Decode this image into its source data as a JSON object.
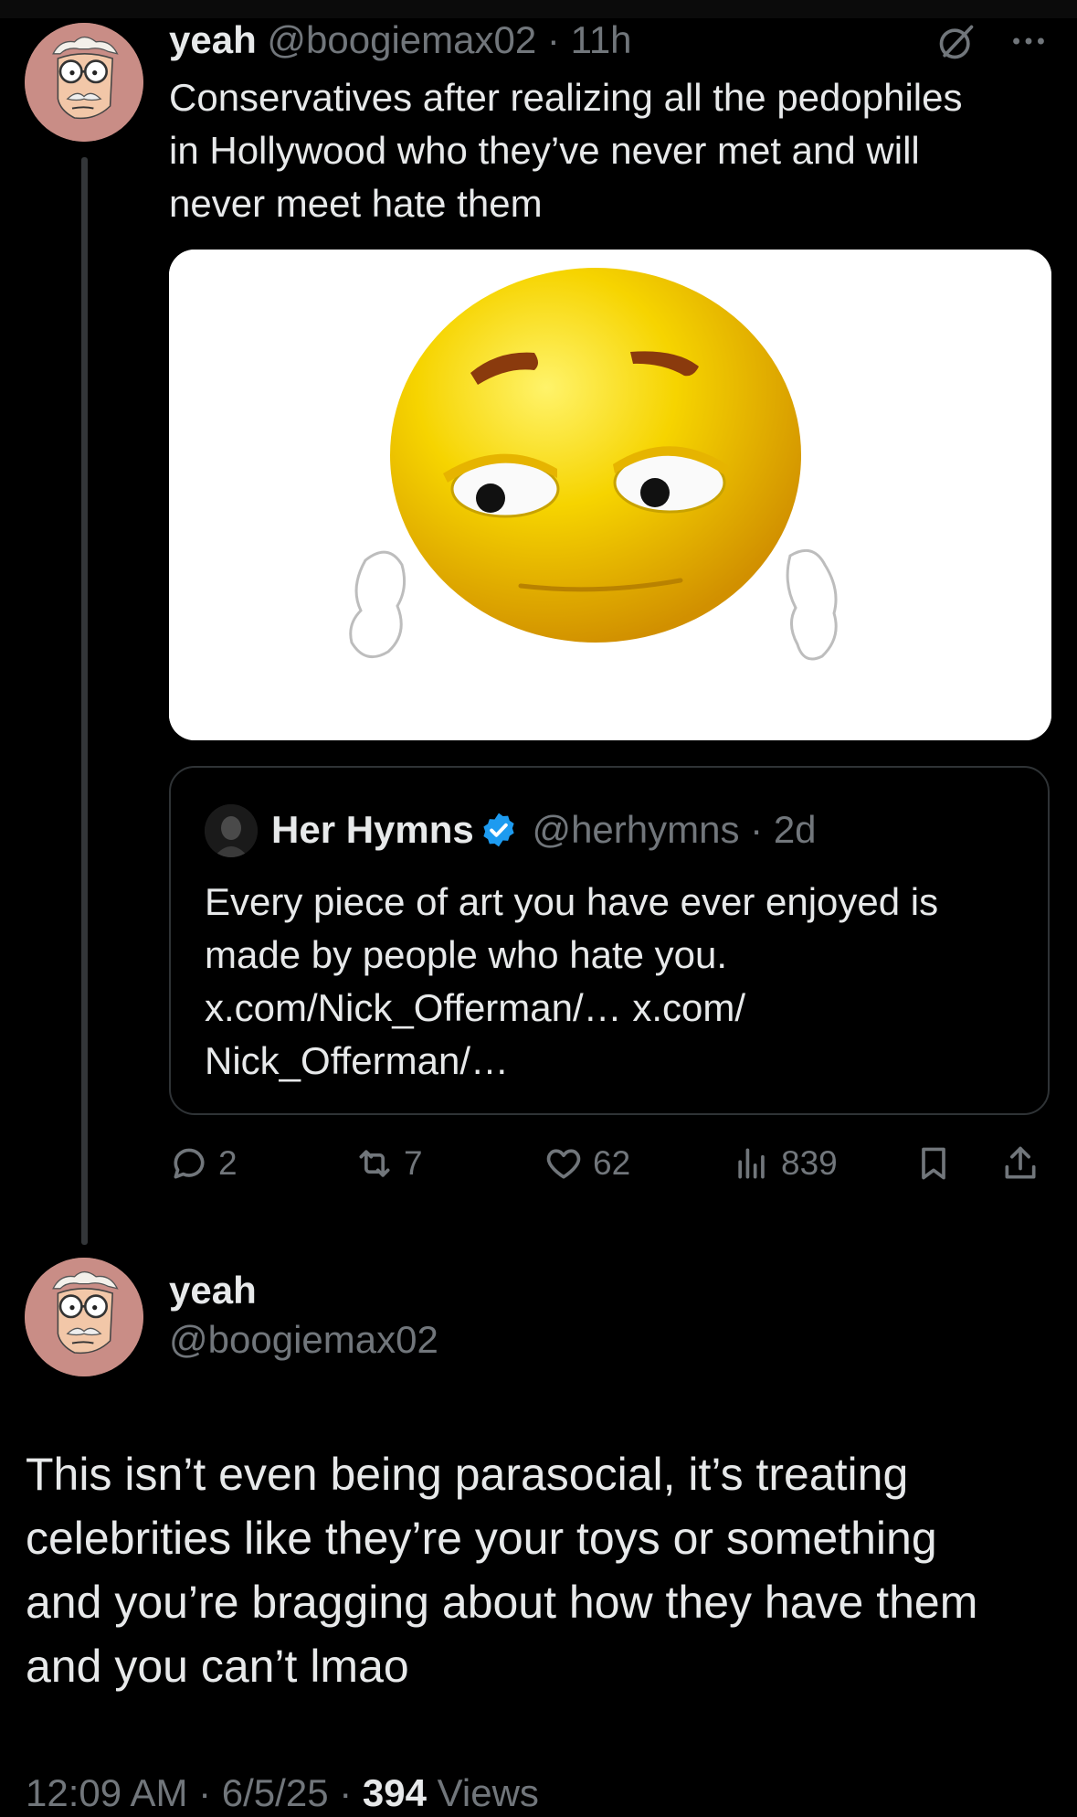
{
  "parent_tweet": {
    "display_name": "yeah",
    "handle": "@boogiemax02",
    "separator": "·",
    "time": "11h",
    "text": "Conservatives after realizing all the pedophiles\nin Hollywood who they’ve never met and will\nnever meet hate them",
    "media_description": "sad-emoji-with-white-gloves",
    "quote": {
      "display_name": "Her Hymns",
      "handle": "@herhymns",
      "separator": "·",
      "time": "2d",
      "text": "Every piece of art you have ever enjoyed is\nmade by people who hate you.\nx.com/Nick_Offerman/… x.com/\nNick_Offerman/…",
      "verified_color": "#1d9bf0"
    },
    "actions": {
      "replies": "2",
      "reposts": "7",
      "likes": "62",
      "views": "839"
    }
  },
  "main_tweet": {
    "display_name": "yeah",
    "handle": "@boogiemax02",
    "text": "This isn’t even being parasocial, it’s treating\ncelebrities like they’re your toys or something\nand you’re bragging about how they have them\nand you can’t lmao",
    "timestamp": "12:09 AM · 6/5/25 · ",
    "views_count": "394",
    "views_label": " Views"
  },
  "icons": [
    "grok-icon",
    "more-icon",
    "reply-icon",
    "repost-icon",
    "like-icon",
    "views-icon",
    "bookmark-icon",
    "share-icon",
    "verified-badge-icon"
  ],
  "colors": {
    "background": "#000000",
    "text": "#e7e9ea",
    "muted": "#71767b",
    "border": "#2f3336",
    "accent": "#1d9bf0"
  }
}
